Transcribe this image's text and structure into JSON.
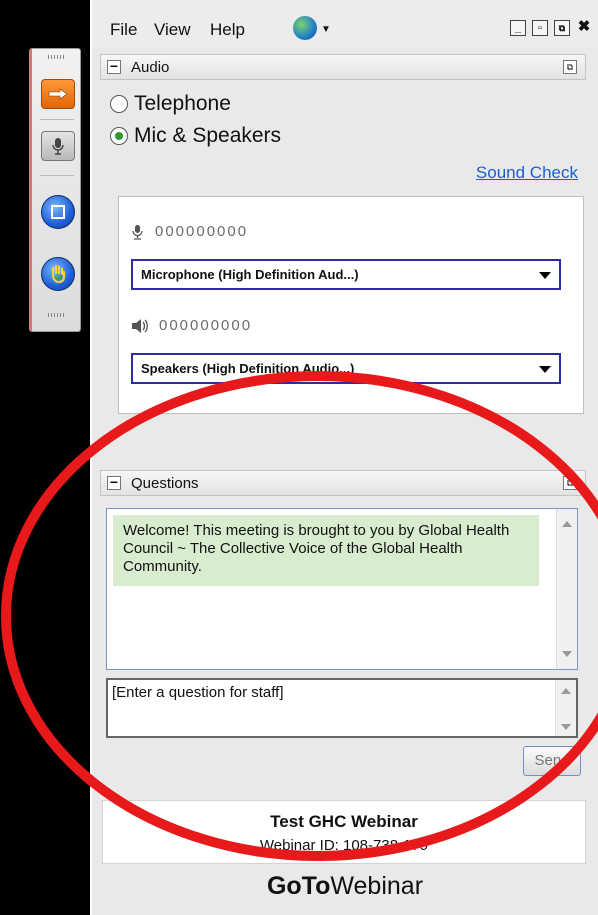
{
  "menu": {
    "file": "File",
    "view": "View",
    "help": "Help"
  },
  "audio": {
    "title": "Audio",
    "options": [
      "Telephone",
      "Mic & Speakers"
    ],
    "selected": "Mic & Speakers",
    "sound_check": "Sound Check",
    "microphone_level": "000000000",
    "speaker_level": "000000000",
    "microphone_device": "Microphone (High Definition Aud...)",
    "speaker_device": "Speakers (High Definition Audio...)"
  },
  "questions": {
    "title": "Questions",
    "welcome_message": "Welcome! This meeting is brought to you by Global Health Council ~ The Collective Voice of the Global Health Community.",
    "input_placeholder": "[Enter a question for staff]",
    "send_label": "Send"
  },
  "webinar": {
    "title": "Test GHC Webinar",
    "id_text": "Webinar ID: 108-738-179"
  },
  "brand": {
    "bold": "GoTo",
    "regular": "Webinar"
  },
  "colors": {
    "annotation": "#e8191a",
    "link": "#1a5fd0",
    "highlight": "#d8eccf",
    "toolbar_arrow": "#f07a12"
  }
}
